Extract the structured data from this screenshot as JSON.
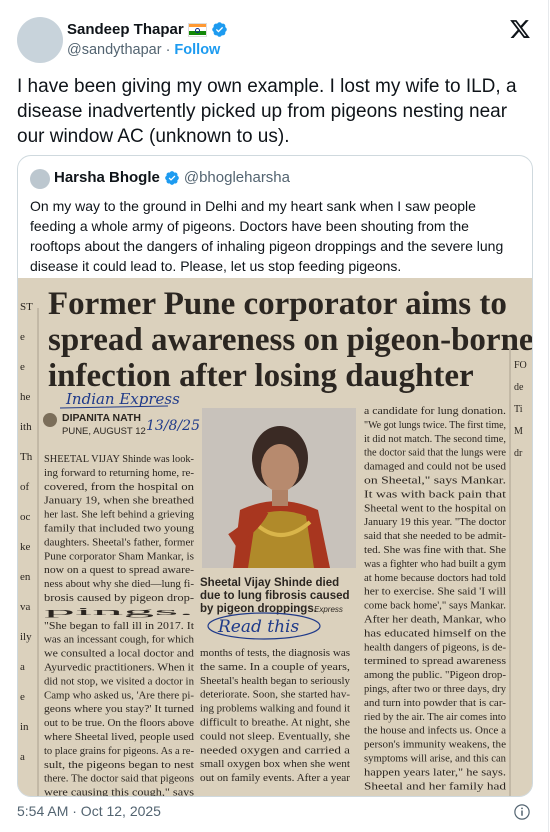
{
  "author": {
    "name": "Sandeep Thapar",
    "handle": "@sandythapar",
    "follow_label": "Follow"
  },
  "tweet": {
    "text": "I have been giving my own example. I lost my wife to ILD, a disease inadvertently picked up from pigeons nesting near our window AC (unknown to us).",
    "timestamp": "5:54 AM · Oct 12, 2025"
  },
  "quoted": {
    "name": "Harsha Bhogle",
    "handle": "@bhogleharsha",
    "text": "On my way to the ground in Delhi and my heart sank when I saw people feeding a whole army of pigeons. Doctors have been shouting from the rooftops about the dangers of inhaling pigeon droppings and the severe lung disease it could lead to. Please, let us stop feeding pigeons."
  },
  "clipping": {
    "headline": [
      "Former Pune corporator aims to",
      "spread awareness on pigeon-borne",
      "infection after losing daughter"
    ],
    "handwritten_source": "Indian Express",
    "handwritten_date": "13/8/25",
    "handwritten_note": "Read this",
    "byline": "DIPANITA NATH",
    "dateline": "PUNE, AUGUST 12",
    "caption": [
      "Sheetal Vijay Shinde died",
      "due to lung fibrosis caused",
      "by pigeon droppings."
    ],
    "caption_credit": "Express",
    "col1": [
      "SHEETAL VIJAY Shinde was look-",
      "ing forward to returning home, re-",
      "covered, from the hospital on",
      "January 19, when she breathed",
      "her last. She left behind a grieving",
      "family that included two young",
      "daughters. Sheetal's father, former",
      "Pune corporator Sham Mankar, is",
      "now on a quest to spread aware-",
      "ness about why she died—lung fi-",
      "brosis caused by pigeon drop-",
      "pings.",
      "\"She began to fall ill in 2017. It",
      "was an incessant cough, for which",
      "we consulted a local doctor and",
      "Ayurvedic practitioners. When it",
      "did not stop, we visited a doctor in",
      "Camp who asked us, 'Are there pi-",
      "geons where you stay?' It turned",
      "out to be true. On the floors above",
      "where Sheetal lived, people used",
      "to place grains for pigeons. As a re-",
      "sult, the pigeons began to nest",
      "there. The doctor said that pigeons",
      "were causing this cough,\" says"
    ],
    "col2": [
      "months of tests, the diagnosis was",
      "the same. In a couple of years,",
      "Sheetal's health began to seriously",
      "deteriorate. Soon, she started hav-",
      "ing problems walking and found it",
      "difficult to breathe. At night, she",
      "could not sleep. Eventually, she",
      "needed oxygen and carried a",
      "small oxygen box when she went",
      "out on family events. After a year"
    ],
    "col3": [
      "a candidate for lung donation.",
      "\"We got lungs twice. The first time,",
      "it did not match. The second time,",
      "the doctor said that the lungs were",
      "damaged and could not be used",
      "on Sheetal,\" says Mankar.",
      "It was with back pain that",
      "Sheetal went to the hospital on",
      "January 19 this year. \"The doctor",
      "said that she needed to be admit-",
      "ted. She was fine with that. She",
      "was a fighter who had built a gym",
      "at home because doctors had told",
      "her to exercise. She said 'I will",
      "come back home',\" says Mankar.",
      "After her death, Mankar, who",
      "has educated himself on the",
      "health dangers of pigeons, is de-",
      "termined to spread awareness",
      "among the public. \"Pigeon drop-",
      "pings, after two or three days, dry",
      "and turn into powder that is car-",
      "ried by the air. The air comes into",
      "the house and infects us. Once a",
      "person's immunity weakens, the",
      "symptoms will arise, and this can",
      "happen years later,\" he says.",
      "Sheetal and her family had",
      "changed houses twice, but the in-"
    ],
    "edge_left": [
      "ST",
      "e",
      "e",
      "he",
      "ith",
      "Th",
      "of",
      "oc",
      "ke",
      "en",
      "va",
      "ily",
      "a",
      "e",
      "in",
      "a"
    ],
    "edge_right": [
      "FO",
      "de",
      "Ti",
      "M",
      "dr"
    ]
  },
  "icons": {
    "verified": "verified-badge-icon",
    "logo": "x-logo-icon",
    "info": "info-icon"
  },
  "colors": {
    "accent": "#1d9bf0",
    "muted": "#536471",
    "border": "#cfd9de"
  }
}
